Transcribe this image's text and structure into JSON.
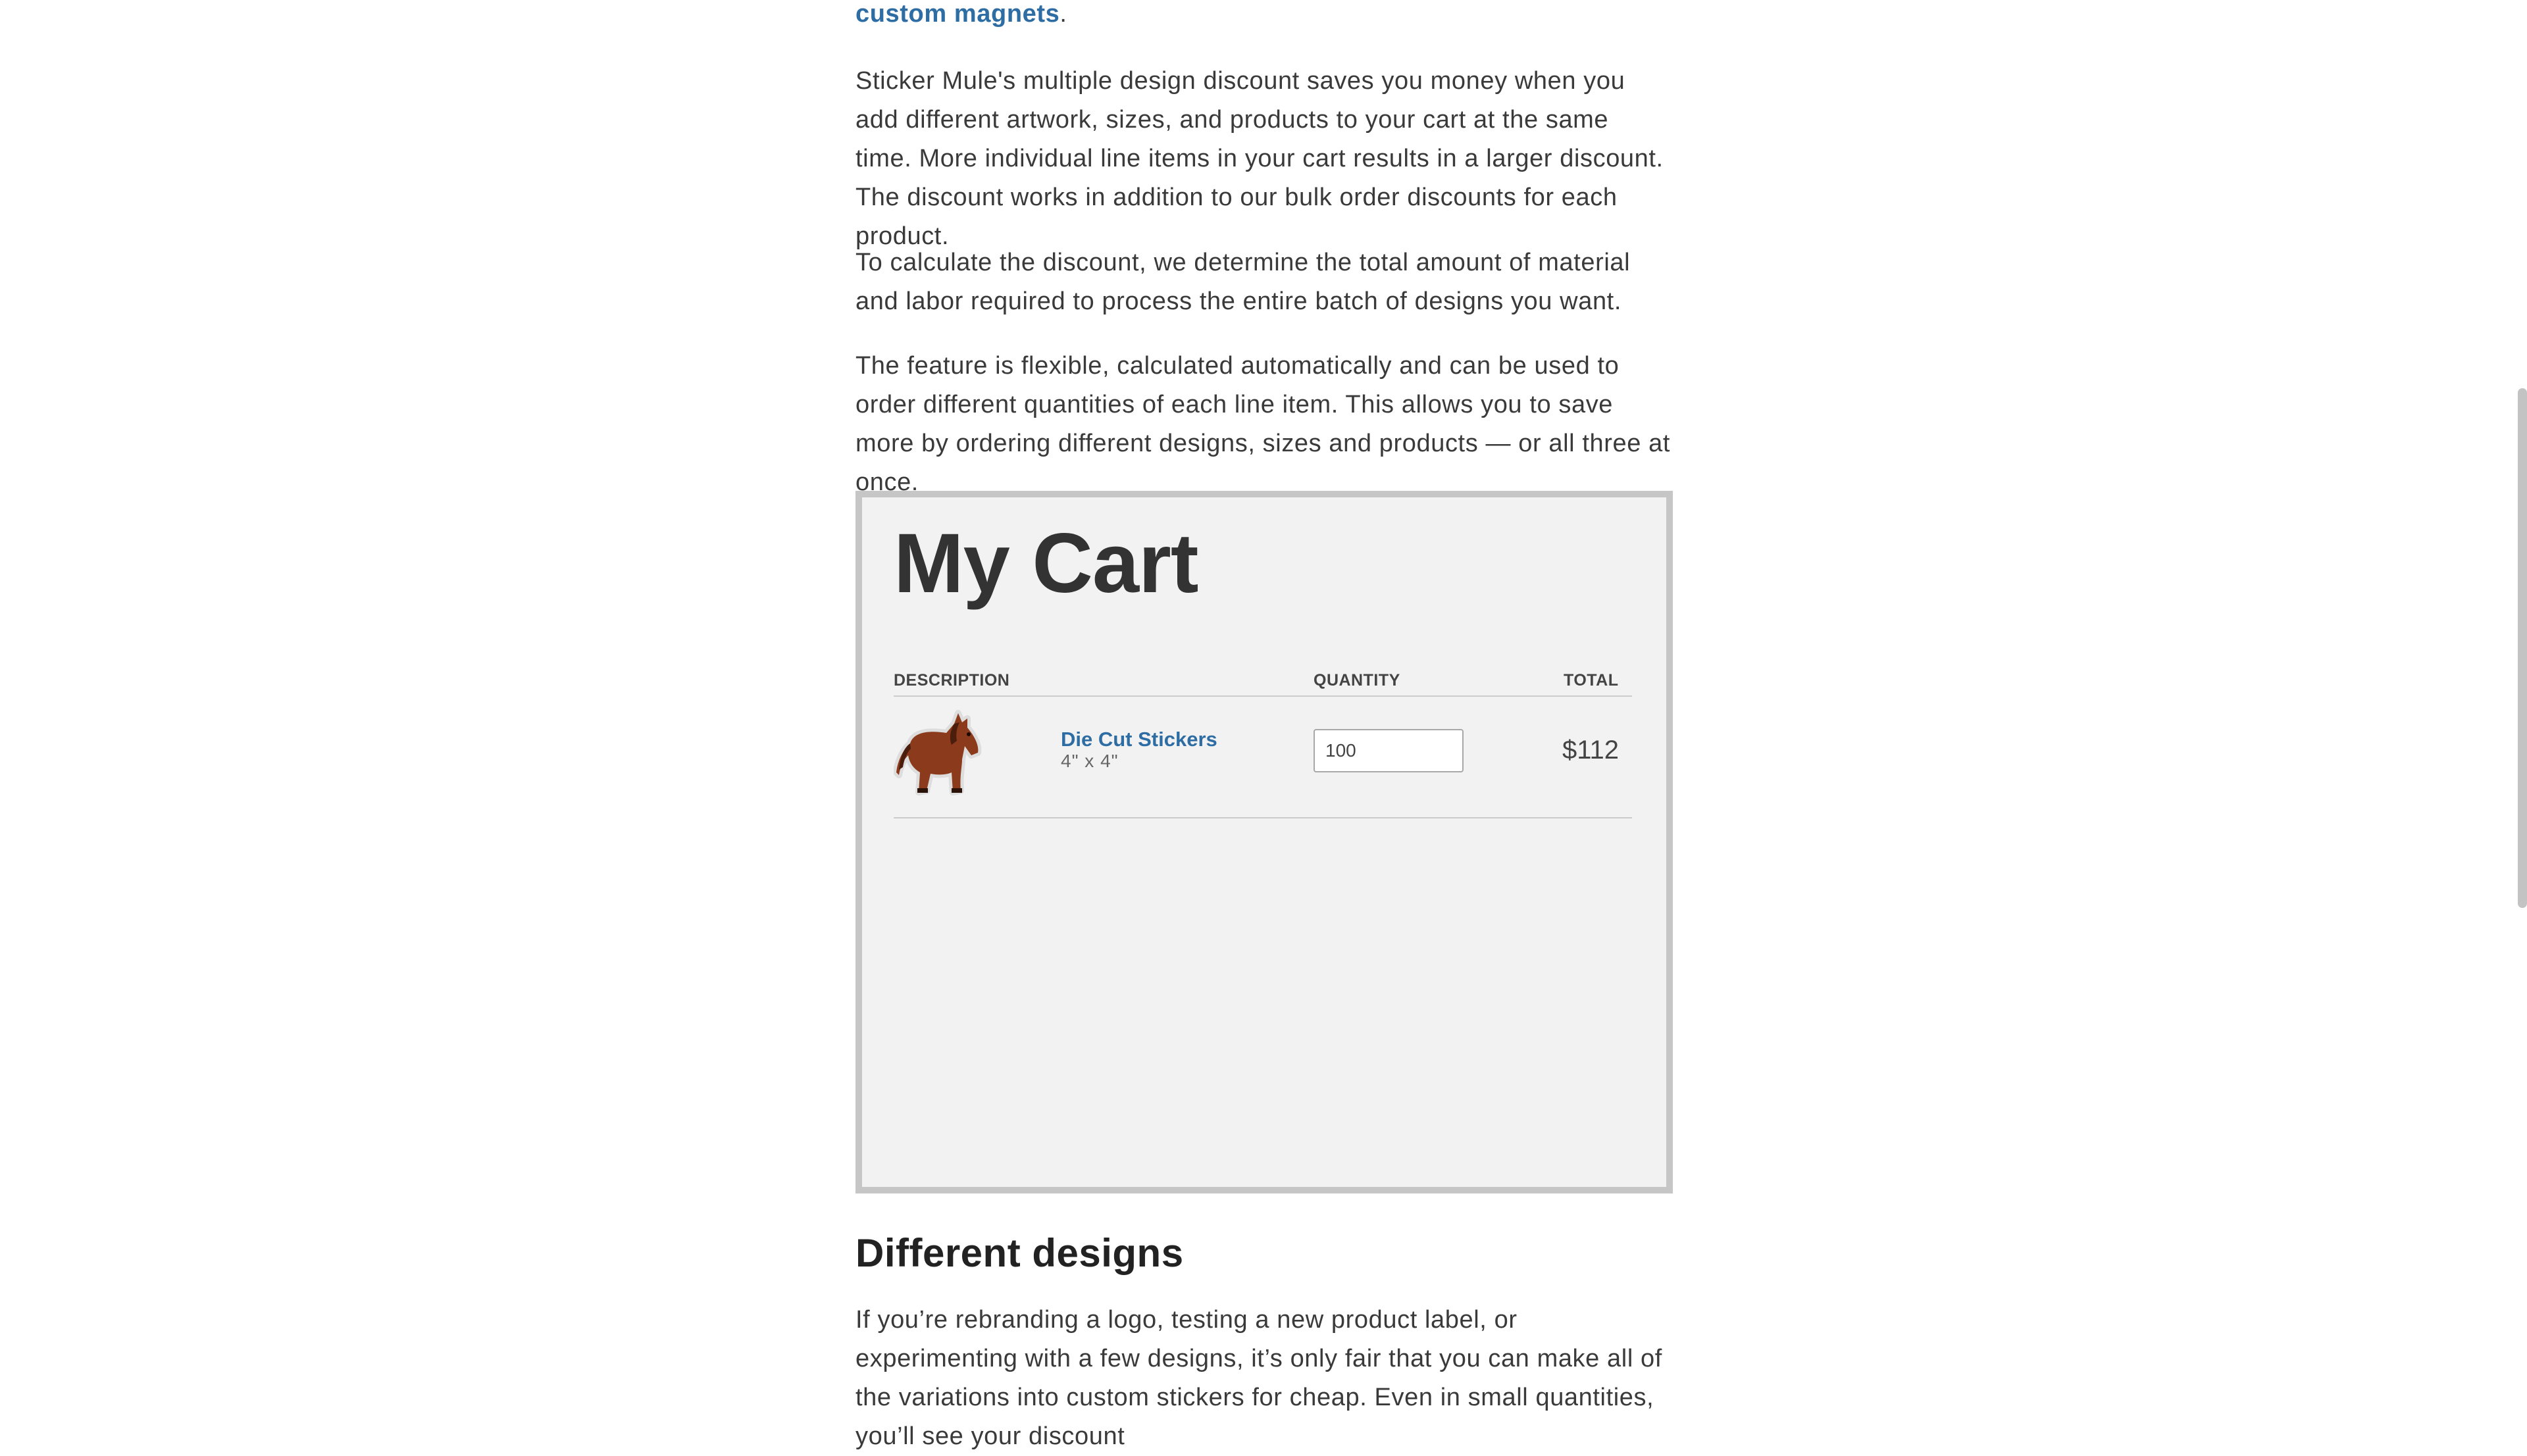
{
  "intro_tail": {
    "link": "custom magnets",
    "after": "."
  },
  "paragraphs": {
    "p1": "Sticker Mule's multiple design discount saves you money when you add different artwork, sizes, and products to your cart at the same time. More individual line items in your cart results in a larger discount. The discount works in addition to our bulk order discounts for each product.",
    "p2": "To calculate the discount, we determine the total amount of material and labor required to process the entire batch of designs you want.",
    "p3": "The feature is flexible, calculated automatically and can be used to order different quantities of each line item. This allows you to save more by ordering different designs, sizes and products — or all three at once.",
    "p4": "If you’re rebranding a logo, testing a new product label, or experimenting with a few designs, it’s only fair that you can make all of the variations into custom stickers for cheap. Even in small quantities, you’ll see your discount"
  },
  "cart": {
    "title": "My Cart",
    "headers": {
      "description": "DESCRIPTION",
      "quantity": "QUANTITY",
      "total": "TOTAL"
    },
    "item": {
      "name": "Die Cut Stickers",
      "size": "4\" x 4\"",
      "quantity": "100",
      "total": "$112",
      "image_icon": "horse-sticker-icon"
    }
  },
  "heading": "Different designs",
  "colors": {
    "link": "#2e6da4",
    "text": "#3a3a3a",
    "cart_bg": "#f2f2f2",
    "cart_border": "#c6c6c6"
  }
}
